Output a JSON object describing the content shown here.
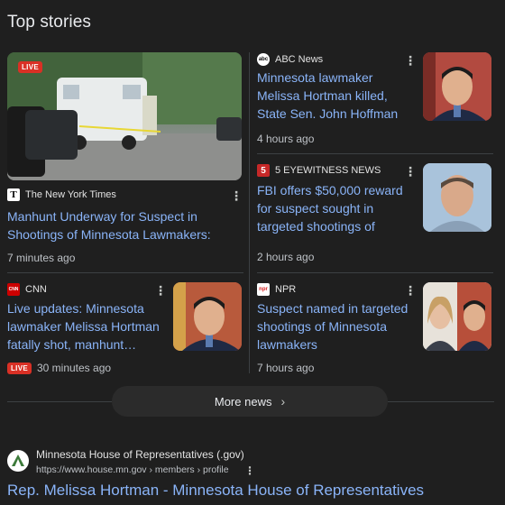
{
  "section_title": "Top stories",
  "stories": [
    {
      "source": "The New York Times",
      "logo_text": "T",
      "headline": "Manhunt Underway for Suspect in Shootings of Minnesota Lawmakers: Live…",
      "time": "7 minutes ago",
      "live": true,
      "live_label": "LIVE",
      "thumb": "police-command-vehicle-photo"
    },
    {
      "source": "ABC News",
      "logo_text": "abc",
      "headline": "Minnesota lawmaker Melissa Hortman killed, State Sen. John Hoffman wounded in…",
      "time": "4 hours ago",
      "live": false,
      "thumb": "man-portrait-photo"
    },
    {
      "source": "5 EYEWITNESS NEWS",
      "logo_text": "5",
      "headline": "FBI offers $50,000 reward for suspect sought in targeted shootings of Minnesota stat…",
      "time": "2 hours ago",
      "live": false,
      "thumb": "suspect-portrait-photo"
    },
    {
      "source": "CNN",
      "logo_text": "CNN",
      "headline": "Live updates: Minnesota lawmaker Melissa Hortman fatally shot, manhunt…",
      "time": "30 minutes ago",
      "live": true,
      "live_label": "LIVE",
      "thumb": "man-portrait-photo"
    },
    {
      "source": "NPR",
      "logo_text": "npr",
      "headline": "Suspect named in targeted shootings of Minnesota lawmakers",
      "time": "7 hours ago",
      "live": false,
      "thumb": "two-portraits-photo"
    }
  ],
  "more_news_label": "More news",
  "result": {
    "site_name": "Minnesota House of Representatives (.gov)",
    "url": "https://www.house.mn.gov › members › profile",
    "title": "Rep. Melissa Hortman - Minnesota House of Representatives"
  },
  "colors": {
    "background": "#1f1f1f",
    "link": "#8ab4f8",
    "live_red": "#d93025"
  }
}
